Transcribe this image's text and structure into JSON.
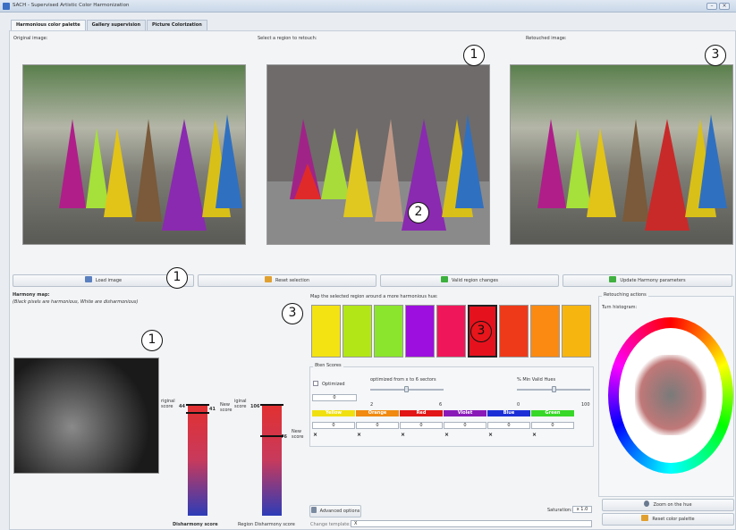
{
  "window": {
    "title": "SACH - Supervised Artistic Color Harmonization",
    "minimize": "–",
    "close": "×"
  },
  "tabs": [
    "Harmonious color palette",
    "Gallery supervision",
    "Picture Colorization"
  ],
  "labels": {
    "original": "Original image:",
    "select": "Select a region to retouch:",
    "retouched": "Retouched image:"
  },
  "buttons": {
    "load": "Load image",
    "reset": "Reset selection",
    "valid": "Valid region changes",
    "update": "Update Harmony parameters",
    "advanced": "Advanced options",
    "zoom": "Zoom on the hue",
    "reset_palette": "Reset color palette"
  },
  "harmony": {
    "title": "Harmony map:",
    "subtitle": "(Black pixels are harmonious, White are disharmonious)"
  },
  "map_label": "Map the selected region around a more harmonious hue:",
  "swatches": [
    "#f4e312",
    "#b2e616",
    "#8be52c",
    "#9c0fde",
    "#f0165a",
    "#e5121e",
    "#ee3a18",
    "#fa8a12",
    "#f7b510"
  ],
  "scores": {
    "title": "8ten Scores",
    "optimized": "Optimized",
    "opt_value": "0",
    "sectors_label": "optimized from x to 6 sectors",
    "sectors_min": "2",
    "sectors_max": "6",
    "valid_label": "% Min Valid Hues",
    "valid_min": "0",
    "valid_max": "100",
    "colors": [
      {
        "name": "Yellow",
        "color": "#f0e010",
        "value": "0"
      },
      {
        "name": "Orange",
        "color": "#f08a10",
        "value": "0"
      },
      {
        "name": "Red",
        "color": "#e21616",
        "value": "0"
      },
      {
        "name": "Violet",
        "color": "#8a1ab8",
        "value": "0"
      },
      {
        "name": "Blue",
        "color": "#1c2fd6",
        "value": "0"
      },
      {
        "name": "Green",
        "color": "#38d828",
        "value": "0"
      }
    ]
  },
  "chart1": {
    "orig_label": "riginal score",
    "orig_value": "44",
    "new_label": "New score",
    "new_value": "41",
    "caption": "Disharmony score",
    "orig_level": 0.44,
    "new_level": 0.41
  },
  "chart2": {
    "orig_label": "iginal score",
    "orig_value": "106",
    "new_label": "New score",
    "new_value": "76",
    "caption": "Region Disharmony score",
    "orig_level": 0.5,
    "new_level": 0.36
  },
  "retouch": {
    "title": "Retouching actions",
    "histogram": "Turn histogram:"
  },
  "saturation": {
    "label": "Saturation:",
    "value": "x 1.0"
  },
  "template": {
    "label": "Change template:",
    "value": "X"
  },
  "callouts": {
    "c1a": "1",
    "c3a": "3",
    "c1b": "1",
    "c2": "2",
    "c3b": "3",
    "c3c": "3",
    "c1c": "1"
  }
}
